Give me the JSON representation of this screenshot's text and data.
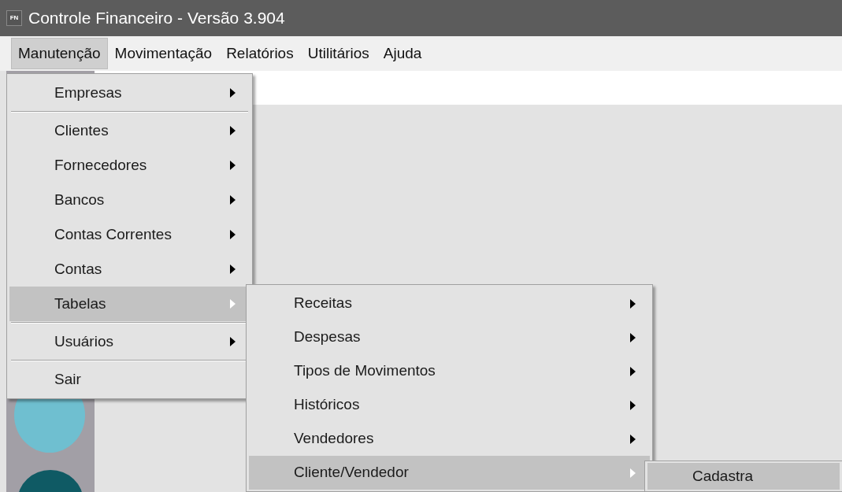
{
  "window": {
    "title": "Controle Financeiro - Versão 3.904",
    "app_icon_text": "FN"
  },
  "menu_bar": [
    {
      "label": "Manutenção",
      "selected": true
    },
    {
      "label": "Movimentação",
      "selected": false
    },
    {
      "label": "Relatórios",
      "selected": false
    },
    {
      "label": "Utilitários",
      "selected": false
    },
    {
      "label": "Ajuda",
      "selected": false
    }
  ],
  "menus": [
    {
      "items": [
        {
          "kind": "item",
          "label": "Empresas",
          "submenu": true,
          "selected": false
        },
        {
          "kind": "separator"
        },
        {
          "kind": "item",
          "label": "Clientes",
          "submenu": true,
          "selected": false
        },
        {
          "kind": "item",
          "label": "Fornecedores",
          "submenu": true,
          "selected": false
        },
        {
          "kind": "item",
          "label": "Bancos",
          "submenu": true,
          "selected": false
        },
        {
          "kind": "item",
          "label": "Contas Correntes",
          "submenu": true,
          "selected": false
        },
        {
          "kind": "item",
          "label": "Contas",
          "submenu": true,
          "selected": false
        },
        {
          "kind": "item",
          "label": "Tabelas",
          "submenu": true,
          "selected": true
        },
        {
          "kind": "separator"
        },
        {
          "kind": "item",
          "label": "Usuários",
          "submenu": true,
          "selected": false
        },
        {
          "kind": "separator"
        },
        {
          "kind": "item",
          "label": "Sair",
          "submenu": false,
          "selected": false
        }
      ]
    },
    {
      "items": [
        {
          "kind": "item",
          "label": "Receitas",
          "submenu": true,
          "selected": false
        },
        {
          "kind": "item",
          "label": "Despesas",
          "submenu": true,
          "selected": false
        },
        {
          "kind": "item",
          "label": "Tipos de Movimentos",
          "submenu": true,
          "selected": false
        },
        {
          "kind": "item",
          "label": "Históricos",
          "submenu": true,
          "selected": false
        },
        {
          "kind": "item",
          "label": "Vendedores",
          "submenu": true,
          "selected": false
        },
        {
          "kind": "item",
          "label": "Cliente/Vendedor",
          "submenu": true,
          "selected": true
        }
      ]
    },
    {
      "items": [
        {
          "kind": "item",
          "label": "Cadastra",
          "submenu": false,
          "selected": true
        }
      ]
    }
  ]
}
